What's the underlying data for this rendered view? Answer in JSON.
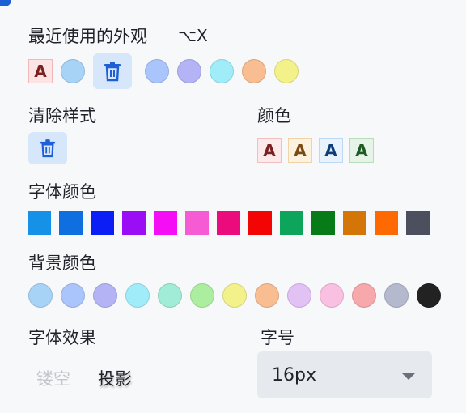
{
  "recent": {
    "label": "最近使用的外观",
    "shortcut": "⌥X",
    "style_letter": "A",
    "style_colors": {
      "text": "#7b2020",
      "bg": "#fde4e4",
      "border": "#f0b8b8"
    },
    "circle_1": "#a7d3f7",
    "circles": [
      "#aac5fb",
      "#b4b3f5",
      "#a1ecf9",
      "#f8bd90",
      "#f3f28a"
    ]
  },
  "clear": {
    "label": "清除样式"
  },
  "color": {
    "label": "颜色",
    "letter": "A",
    "swatches": [
      {
        "text": "#7b2020",
        "bg": "#fde9e9",
        "border": "#f0c0c0"
      },
      {
        "text": "#7a4a10",
        "bg": "#fdf1df",
        "border": "#f0d4a8"
      },
      {
        "text": "#0e3f7a",
        "bg": "#e8f3fd",
        "border": "#bcd8f2"
      },
      {
        "text": "#1d5a26",
        "bg": "#e6f4e7",
        "border": "#b9dcbc"
      }
    ]
  },
  "font_color": {
    "label": "字体颜色",
    "swatches": [
      "#1591e8",
      "#0f6fe0",
      "#0a1ef5",
      "#9b0ef5",
      "#f50ef5",
      "#f75ad5",
      "#ec0b7c",
      "#f40505",
      "#0da45b",
      "#087b19",
      "#d47607",
      "#ff6a00",
      "#4b4f5e"
    ]
  },
  "bg_color": {
    "label": "背景颜色",
    "swatches": [
      "#a7d3f7",
      "#aac5fb",
      "#b4b3f5",
      "#a1ecf9",
      "#a0ecd6",
      "#aceea0",
      "#f3f28a",
      "#f8bd90",
      "#e2c1f5",
      "#f9c0e1",
      "#f6a8ab",
      "#b4b9cd",
      "#222222"
    ]
  },
  "effects": {
    "label": "字体效果",
    "hollow": "镂空",
    "shadow": "投影"
  },
  "size": {
    "label": "字号",
    "value": "16px"
  }
}
